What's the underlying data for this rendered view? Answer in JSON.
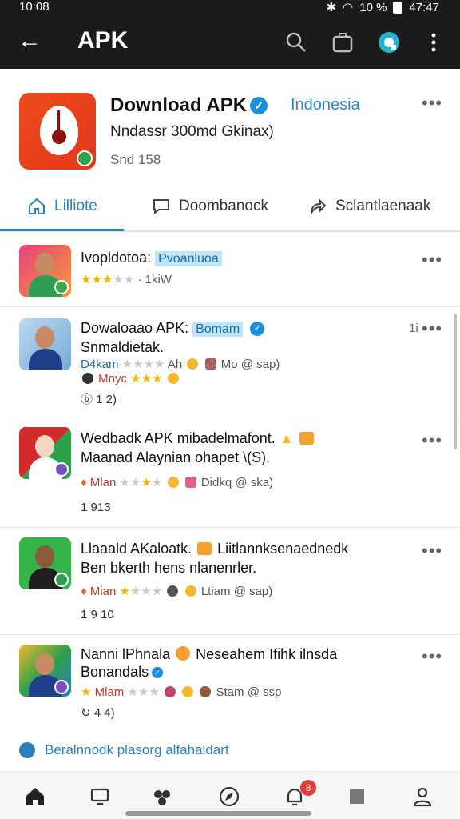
{
  "status": {
    "time": "10:08",
    "signal": "10 %",
    "clock": "47:47"
  },
  "appbar": {
    "title": "APK"
  },
  "app": {
    "title": "Download APK",
    "region": "Indonesia",
    "subtitle": "Nndassr 300md Gkinax)",
    "meta": "Snd 158"
  },
  "tabs": [
    {
      "label": "Lilliote",
      "icon": "home-outline-icon"
    },
    {
      "label": "Doombanock",
      "icon": "chat-bubble-icon"
    },
    {
      "label": "Sclantlaenaak",
      "icon": "share-icon"
    }
  ],
  "items": [
    {
      "title": "Ivopldotoa:",
      "tag": "Pvoanluoa",
      "meta": "· 1kiW",
      "stars_on": 3,
      "stars_total": 5
    },
    {
      "title": "Dowaloaao APK:",
      "tag": "Bomam",
      "line2": "Snmaldietak.",
      "meta_prefix": "D4kam",
      "meta_rest": "Ah",
      "meta_a": "Mo",
      "meta_b": "sap)",
      "meta2": "Mnyc",
      "count": "ⓑ 1 2)",
      "time": "1i",
      "stars_on": 0,
      "stars_total": 4
    },
    {
      "title": "Wedbadk APK mibadelmafont.",
      "line2": "Maanad Alaynian ohapet \\(S).",
      "meta_prefix": "Mlan",
      "meta_a": "Didkq",
      "meta_b": "ska)",
      "count": "1 913",
      "stars_on": 1,
      "stars_total": 4
    },
    {
      "title": "Llaaald AKaloatk.",
      "title2": "Liitlannksenaednedk",
      "line2": "Ben bkerth hens nlanenrler.",
      "meta_prefix": "Mian",
      "meta_a": "Ltiam",
      "meta_b": "sap)",
      "count": "1 9 10",
      "stars_on": 1,
      "stars_total": 4
    },
    {
      "title": "Nanni lPhnala",
      "title2": "Neseahem Ifihk ilnsda",
      "line2": "Bonandals",
      "meta_prefix": "Mlam",
      "meta_a": "Stam",
      "meta_b": "ssp",
      "count": "4 4)",
      "stars_on": 1,
      "stars_total": 4
    }
  ],
  "footer": {
    "link": "Beralnnodk plasorg alfahaldart"
  },
  "nav": [
    "home-icon",
    "screen-icon",
    "group-icon",
    "compass-icon",
    "notification-icon",
    "stop-icon",
    "profile-icon"
  ],
  "nav_badge": "8",
  "colors": {
    "accent": "#2b7fbd",
    "topbar": "#1b1b1b",
    "tag_bg": "#bde4f7"
  }
}
